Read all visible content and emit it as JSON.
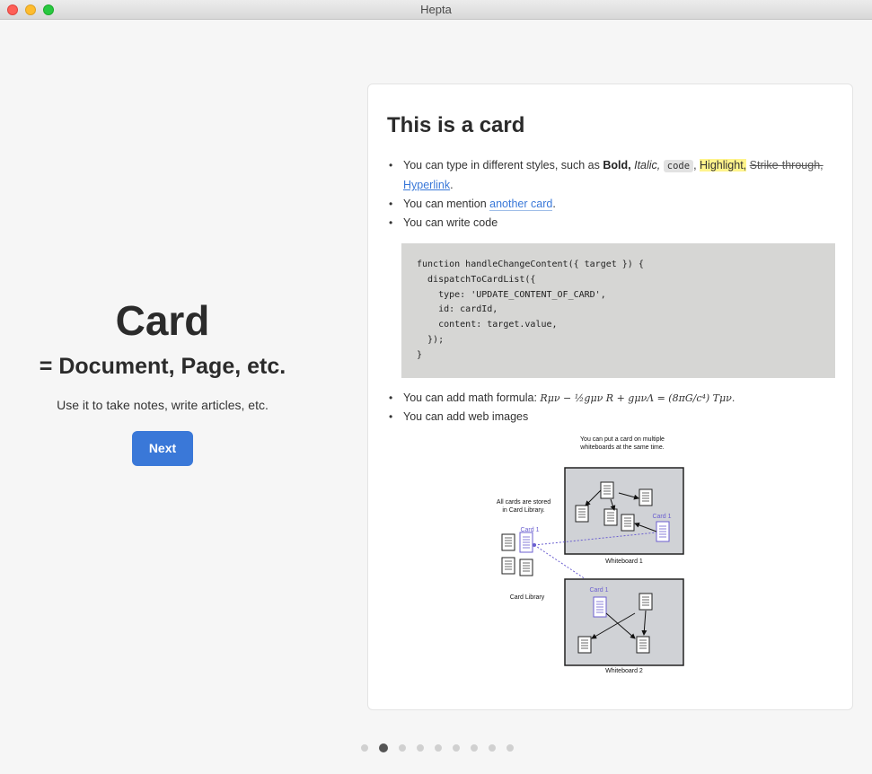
{
  "window": {
    "title": "Hepta"
  },
  "intro": {
    "title": "Card",
    "subtitle": "= Document, Page, etc.",
    "description": "Use it to take notes, write articles, etc.",
    "next_label": "Next"
  },
  "card": {
    "title": "This is a card",
    "bullet1": {
      "prefix": "You can type in different styles, such as ",
      "bold": "Bold,",
      "italic": "Italic,",
      "code": "code",
      "comma": ",",
      "highlight": "Highlight,",
      "strike": "Strike-through,",
      "link": "Hyperlink",
      "end": "."
    },
    "bullet2": {
      "prefix": "You can mention ",
      "mention": "another card",
      "end": "."
    },
    "bullet3": "You can write code",
    "code_block": "function handleChangeContent({ target }) {\n  dispatchToCardList({\n    type: 'UPDATE_CONTENT_OF_CARD',\n    id: cardId,\n    content: target.value,\n  });\n}",
    "bullet4": {
      "prefix": "You can add math formula: ",
      "formula": "Rμν − ½gμν R + gμνΛ = (8πG/c⁴) Tμν."
    },
    "bullet5": "You can add web images"
  },
  "diagram": {
    "note_top_line1": "You can put a card on multiple",
    "note_top_line2": "whiteboards at the same time.",
    "note_left_line1": "All cards are stored",
    "note_left_line2": "in Card Library.",
    "card_label": "Card 1",
    "whiteboard1": "Whiteboard 1",
    "whiteboard2": "Whiteboard 2",
    "library": "Card Library",
    "accent_color": "#6b5fd0"
  },
  "pager": {
    "count": 9,
    "active_index": 1
  }
}
